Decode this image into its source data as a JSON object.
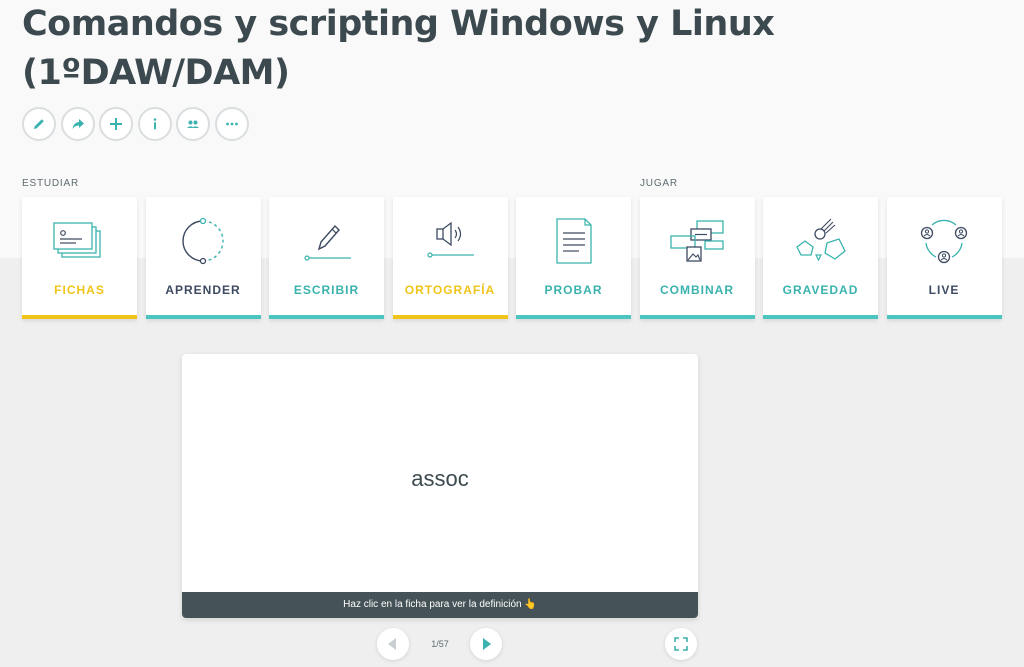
{
  "title": {
    "line1": "Comandos y scripting Windows y Linux",
    "line2": "(1ºDAW/DAM)"
  },
  "actions": [
    "pencil-icon",
    "share-icon",
    "plus-icon",
    "info-icon",
    "people-icon",
    "more-icon"
  ],
  "sections": {
    "study": "ESTUDIAR",
    "play": "JUGAR"
  },
  "modes": [
    {
      "label": "FICHAS",
      "color": "#f0c419",
      "bar": "#f0c419"
    },
    {
      "label": "APRENDER",
      "color": "#3d4a61",
      "bar": "#4cc5c0"
    },
    {
      "label": "ESCRIBIR",
      "color": "#3ab3ae",
      "bar": "#4cc5c0"
    },
    {
      "label": "ORTOGRAFÍA",
      "color": "#f0c419",
      "bar": "#f0c419"
    },
    {
      "label": "PROBAR",
      "color": "#3ab3ae",
      "bar": "#4cc5c0"
    },
    {
      "label": "COMBINAR",
      "color": "#3ab3ae",
      "bar": "#4cc5c0"
    },
    {
      "label": "GRAVEDAD",
      "color": "#3ab3ae",
      "bar": "#4cc5c0"
    },
    {
      "label": "LIVE",
      "color": "#3d4a61",
      "bar": "#4cc5c0"
    }
  ],
  "card": {
    "term": "assoc",
    "hint": "Haz clic en la ficha para ver la definición 👆"
  },
  "navigation": {
    "counter": "1/57"
  },
  "colors": {
    "teal": "#4cc5c0",
    "yellow": "#f0c419",
    "dark": "#455358"
  }
}
